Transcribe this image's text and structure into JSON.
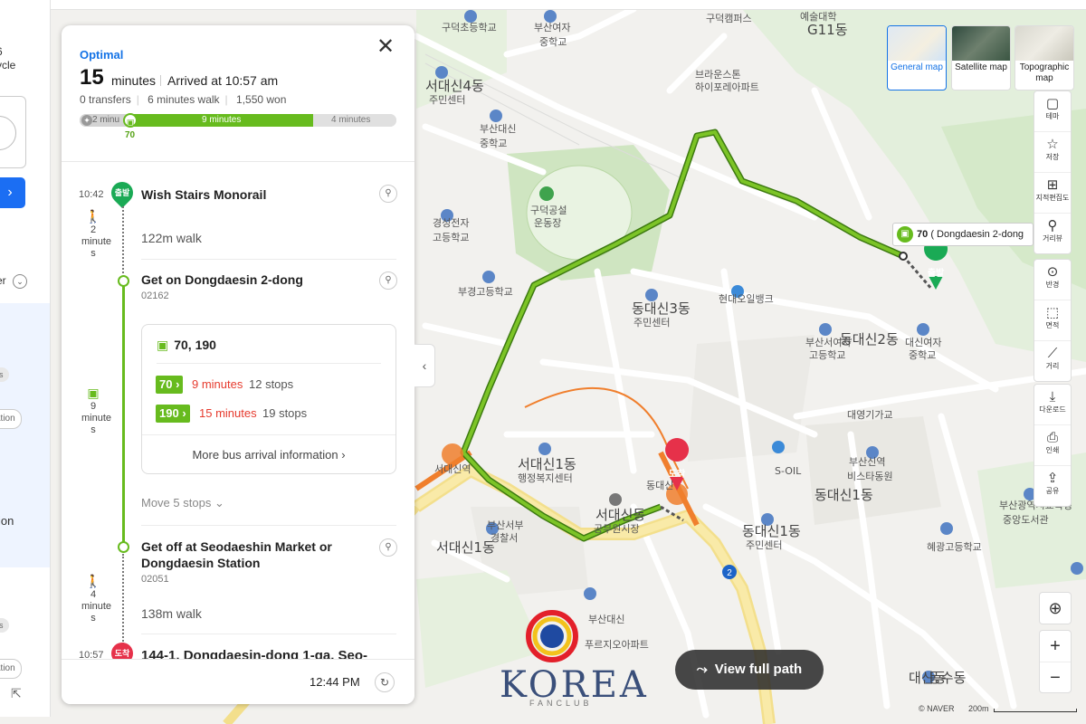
{
  "summary": {
    "badge": "Optimal",
    "duration_value": "15",
    "duration_unit": "minutes",
    "arrival": "Arrived at 10:57 am",
    "transfers": "0 transfers",
    "walk": "6 minutes walk",
    "fare": "1,550 won",
    "bar": {
      "walk1_label": "2 minu",
      "bus_label": "9 minutes",
      "walk2_label": "4 minutes",
      "bus_route": "70",
      "segment_fractions": [
        0.149,
        0.589,
        0.262
      ]
    }
  },
  "timeline": {
    "depart_time": "10:42",
    "depart_pin": "출발",
    "start_stop": "Wish Stairs Monorail",
    "walk1_dur": [
      "2",
      "minute",
      "s"
    ],
    "walk1_text": "122m walk",
    "board_stop": "Get on Dongdaesin 2-dong",
    "board_id": "02162",
    "bus_dur": [
      "9",
      "minute",
      "s"
    ],
    "buses_title": "70, 190",
    "routes": [
      {
        "no": "70",
        "arrival": "9 minutes",
        "stops": "12 stops"
      },
      {
        "no": "190",
        "arrival": "15 minutes",
        "stops": "19 stops"
      }
    ],
    "more_info": "More bus arrival information",
    "move_stops": "Move 5 stops",
    "alight_stop_l1": "Get off at Seodaeshin Market or",
    "alight_stop_l2": "Dongdaesin Station",
    "alight_id": "02051",
    "walk2_dur": [
      "4",
      "minute",
      "s"
    ],
    "walk2_text": "138m walk",
    "arrive_time": "10:57",
    "arrive_pin": "도착",
    "dest_name": "144-1, Dongdaesin-dong 1-ga, Seo-"
  },
  "footer": {
    "time": "12:44 PM"
  },
  "map_types": [
    {
      "label": "General map",
      "selected": true
    },
    {
      "label": "Satellite map",
      "selected": false
    },
    {
      "label": "Topographic map",
      "selected": false
    }
  ],
  "tools": [
    {
      "icon": "theme-icon",
      "glyph": "▢",
      "label": "테마"
    },
    {
      "icon": "star-icon",
      "glyph": "☆",
      "label": "저장"
    },
    {
      "icon": "cadastral-icon",
      "glyph": "⊞",
      "label": "지적편집도"
    },
    {
      "icon": "streetview-icon",
      "glyph": "⚲",
      "label": "거리뷰"
    },
    {
      "icon": "radius-icon",
      "glyph": "⊙",
      "label": "반경"
    },
    {
      "icon": "area-icon",
      "glyph": "⬚",
      "label": "면적"
    },
    {
      "icon": "ruler-icon",
      "glyph": "⟋",
      "label": "거리"
    },
    {
      "icon": "download-icon",
      "glyph": "⤓",
      "label": "다운로드"
    },
    {
      "icon": "print-icon",
      "glyph": "⎙",
      "label": "인쇄"
    },
    {
      "icon": "share-icon",
      "glyph": "⇪",
      "label": "공유"
    }
  ],
  "map": {
    "callout_route": "70",
    "callout_text": "( Dongdaesin 2-dong",
    "start_marker": "출발",
    "end_marker": "도착",
    "view_full_path": "View full path",
    "attribution": "© NAVER",
    "scale": "200m",
    "labels": [
      "구덕초등학교",
      "부산여자",
      "중학교",
      "구덕캠퍼스",
      "예술대학",
      "G11동",
      "브라운스톤",
      "하이포레아파트",
      "서대신4동",
      "주민센터",
      "부산대신",
      "중학교",
      "구덕공설",
      "운동장",
      "경성전자",
      "고등학교",
      "부경고등학교",
      "동대신3동",
      "주민센터",
      "현대오일뱅크",
      "부산서여자",
      "고등학교",
      "동대신2동",
      "대신여자",
      "중학교",
      "대영기가교",
      "서대신1동",
      "행정복지센터",
      "S-OIL",
      "부산신역",
      "비스타동원",
      "동대신1동",
      "서대신동",
      "공무원시장",
      "부산서부",
      "경찰서",
      "서대신1동",
      "동대신1동",
      "주민센터",
      "혜광고등학교",
      "부산광역시교육청",
      "중앙도서관",
      "부산대신",
      "푸르지오아파트",
      "서대신역",
      "동대신",
      "대신동",
      "동수동"
    ]
  },
  "left_panel": {
    "frag1": "6",
    "frag2": "ycle",
    "frag_er": "er",
    "chip1": "es",
    "chip2": "ation",
    "chip3": "es",
    "chip4": "ation",
    "frag_ion": "ion"
  },
  "brand": {
    "logo_text": "KOREA",
    "logo_sub": "FANCLUB"
  },
  "colors": {
    "accent": "#1473e6",
    "bus": "#67bb1e",
    "start": "#1aaa55",
    "end": "#e6314a",
    "rail": "#f07f2d"
  }
}
